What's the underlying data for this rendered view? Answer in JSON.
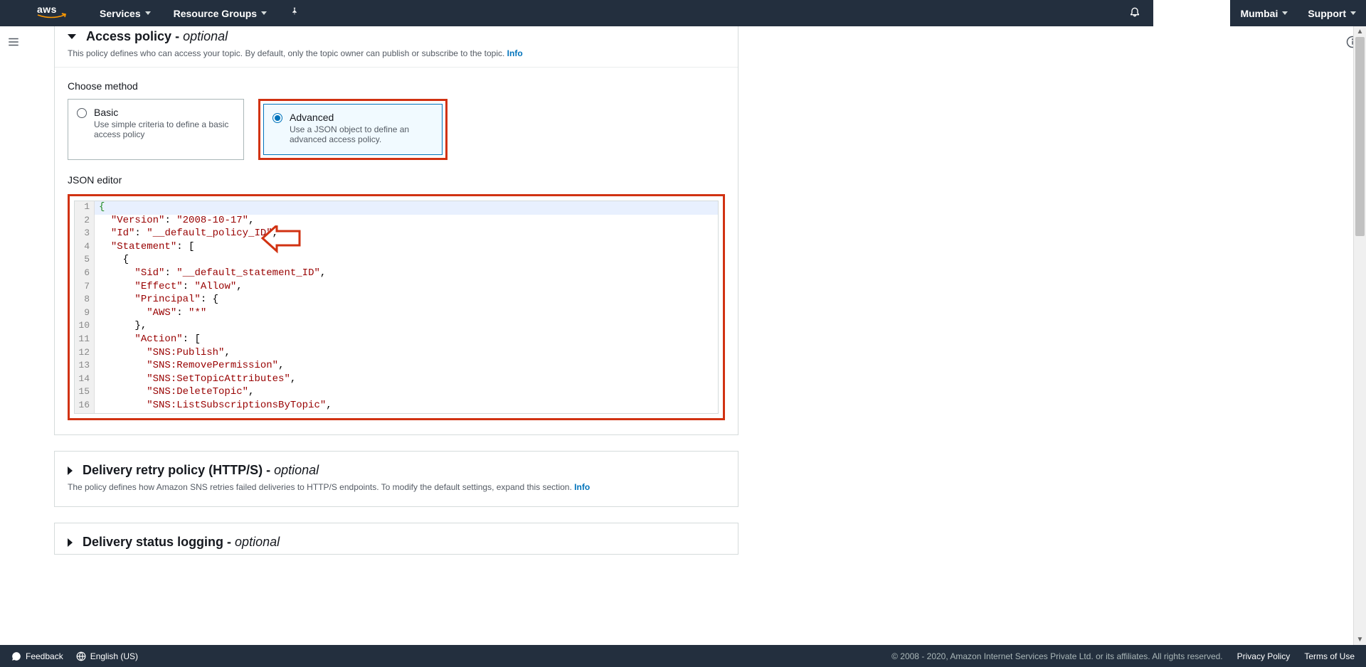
{
  "header": {
    "services": "Services",
    "resource_groups": "Resource Groups",
    "region": "Mumbai",
    "support": "Support"
  },
  "access_policy": {
    "title": "Access policy",
    "suffix": " - ",
    "optional": "optional",
    "desc": "This policy defines who can access your topic. By default, only the topic owner can publish or subscribe to the topic. ",
    "info": "Info",
    "choose_method": "Choose method",
    "basic_title": "Basic",
    "basic_desc": "Use simple criteria to define a basic access policy",
    "advanced_title": "Advanced",
    "advanced_desc": "Use a JSON object to define an advanced access policy.",
    "json_editor_label": "JSON editor"
  },
  "code": {
    "lines": [
      {
        "n": "1",
        "html": "<span class='tok-punct'>{</span>"
      },
      {
        "n": "2",
        "html": "  <span class='tok-key'>\"Version\"</span><span class='tok-black'>:</span> <span class='tok-str'>\"2008-10-17\"</span><span class='tok-black'>,</span>"
      },
      {
        "n": "3",
        "html": "  <span class='tok-key'>\"Id\"</span><span class='tok-black'>:</span> <span class='tok-str'>\"__default_policy_ID\"</span><span class='tok-black'>,</span>"
      },
      {
        "n": "4",
        "html": "  <span class='tok-key'>\"Statement\"</span><span class='tok-black'>:</span> <span class='tok-black'>[</span>"
      },
      {
        "n": "5",
        "html": "    <span class='tok-black'>{</span>"
      },
      {
        "n": "6",
        "html": "      <span class='tok-key'>\"Sid\"</span><span class='tok-black'>:</span> <span class='tok-str'>\"__default_statement_ID\"</span><span class='tok-black'>,</span>"
      },
      {
        "n": "7",
        "html": "      <span class='tok-key'>\"Effect\"</span><span class='tok-black'>:</span> <span class='tok-str'>\"Allow\"</span><span class='tok-black'>,</span>"
      },
      {
        "n": "8",
        "html": "      <span class='tok-key'>\"Principal\"</span><span class='tok-black'>:</span> <span class='tok-black'>{</span>"
      },
      {
        "n": "9",
        "html": "        <span class='tok-key'>\"AWS\"</span><span class='tok-black'>:</span> <span class='tok-str'>\"*\"</span>"
      },
      {
        "n": "10",
        "html": "      <span class='tok-black'>},</span>"
      },
      {
        "n": "11",
        "html": "      <span class='tok-key'>\"Action\"</span><span class='tok-black'>:</span> <span class='tok-black'>[</span>"
      },
      {
        "n": "12",
        "html": "        <span class='tok-str'>\"SNS:Publish\"</span><span class='tok-black'>,</span>"
      },
      {
        "n": "13",
        "html": "        <span class='tok-str'>\"SNS:RemovePermission\"</span><span class='tok-black'>,</span>"
      },
      {
        "n": "14",
        "html": "        <span class='tok-str'>\"SNS:SetTopicAttributes\"</span><span class='tok-black'>,</span>"
      },
      {
        "n": "15",
        "html": "        <span class='tok-str'>\"SNS:DeleteTopic\"</span><span class='tok-black'>,</span>"
      },
      {
        "n": "16",
        "html": "        <span class='tok-str'>\"SNS:ListSubscriptionsByTopic\"</span><span class='tok-black'>,</span>"
      }
    ]
  },
  "delivery_retry": {
    "title": "Delivery retry policy (HTTP/S)",
    "suffix": " - ",
    "optional": "optional",
    "desc": "The policy defines how Amazon SNS retries failed deliveries to HTTP/S endpoints. To modify the default settings, expand this section. ",
    "info": "Info"
  },
  "delivery_status": {
    "title": "Delivery status logging",
    "suffix": " - ",
    "optional": "optional"
  },
  "footer": {
    "feedback": "Feedback",
    "language": "English (US)",
    "copyright": "© 2008 - 2020, Amazon Internet Services Private Ltd. or its affiliates. All rights reserved.",
    "privacy": "Privacy Policy",
    "terms": "Terms of Use"
  }
}
